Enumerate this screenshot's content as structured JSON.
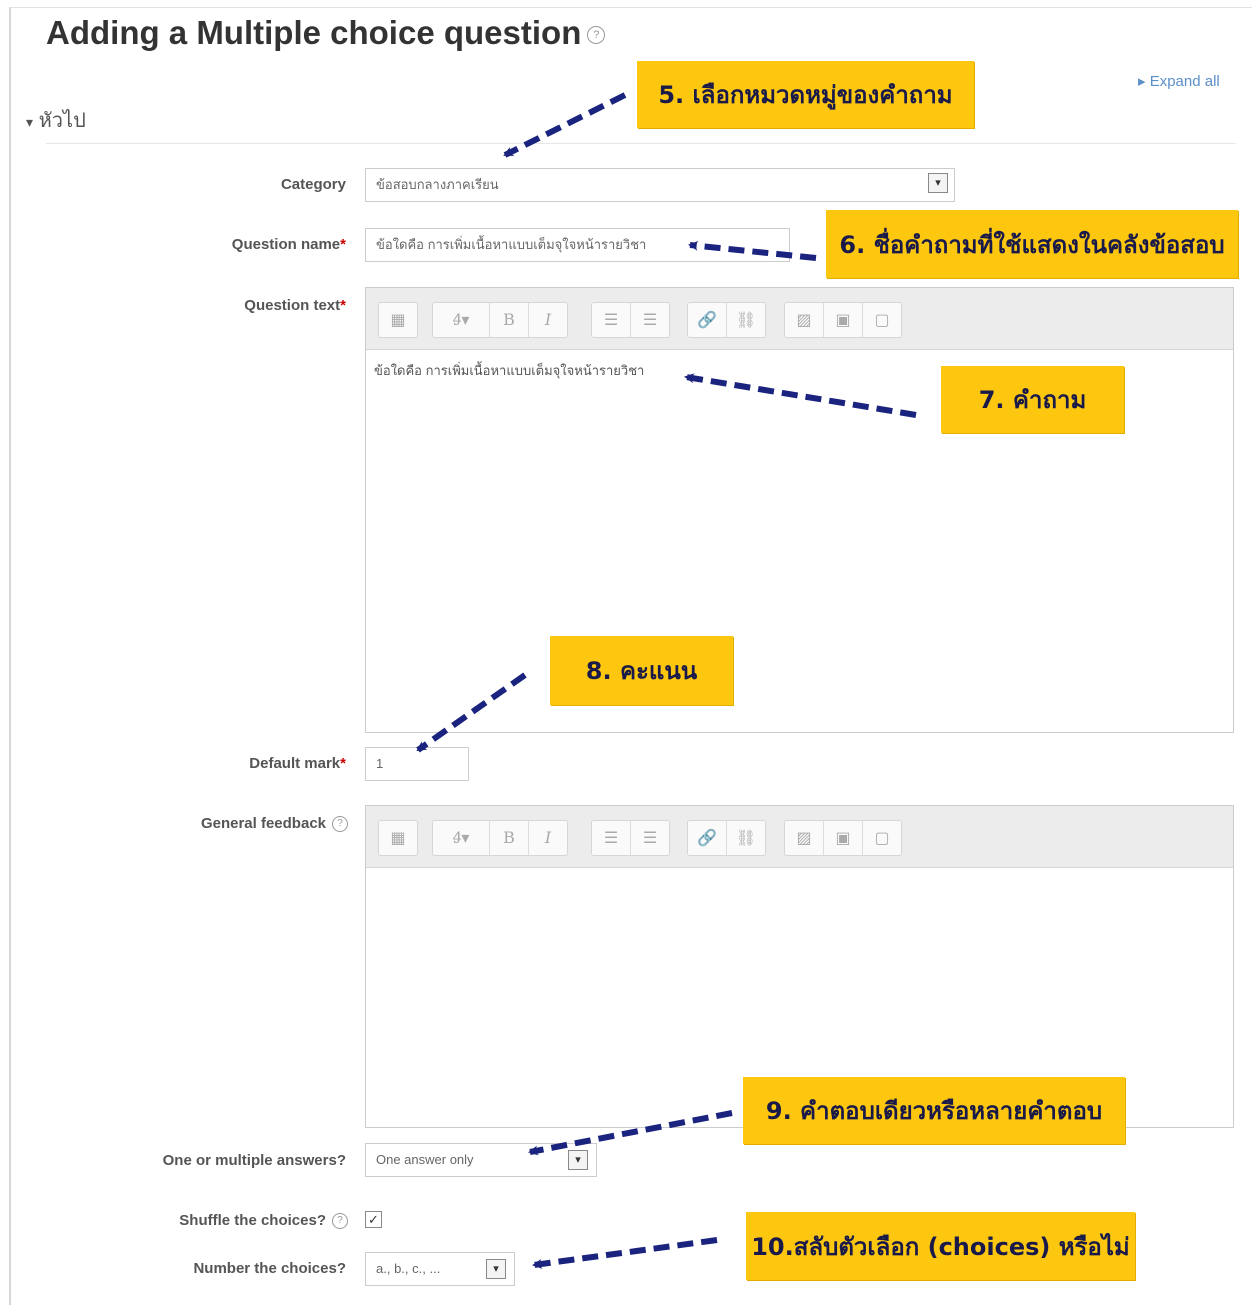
{
  "page": {
    "title": "Adding a Multiple choice question",
    "expand_all": "Expand all",
    "section": "หัวไป"
  },
  "form": {
    "category_label": "Category",
    "category_value": "ข้อสอบกลางภาคเรียน",
    "question_name_label": "Question name",
    "question_name_value": "ข้อใดคือ การเพิ่มเนื้อหาแบบเต็มจุใจหน้ารายวิชา",
    "question_text_label": "Question text",
    "question_text_value": "ข้อใดคือ การเพิ่มเนื้อหาแบบเต็มจุใจหน้ารายวิชา",
    "default_mark_label": "Default mark",
    "default_mark_value": "1",
    "general_feedback_label": "General feedback",
    "general_feedback_value": "",
    "answers_label": "One or multiple answers?",
    "answers_value": "One answer only",
    "shuffle_label": "Shuffle the choices?",
    "shuffle_checked": true,
    "number_label": "Number the choices?",
    "number_value": "a., b., c., ...",
    "required_marker": "*"
  },
  "toolbar": {
    "buttons": [
      "more-icon",
      "font-style-icon",
      "bold-icon",
      "italic-icon",
      "bullet-list-icon",
      "numbered-list-icon",
      "link-icon",
      "unlink-icon",
      "image-icon",
      "media-icon",
      "manage-files-icon"
    ],
    "glyphs": {
      "more": "▦",
      "style": "Ꜭ▾",
      "bold": "B",
      "italic": "I",
      "ul": "☰",
      "ol": "☰",
      "link": "🔗",
      "unlink": "⛓",
      "image": "▨",
      "media": "▣",
      "files": "▢"
    }
  },
  "annotations": {
    "note5": "5. เลือกหมวดหมู่ของคำถาม",
    "note6": "6. ชื่อคำถามที่ใช้แสดงในคลังข้อสอบ",
    "note7": "7. คำถาม",
    "note8": "8. คะแนน",
    "note9": "9. คำตอบเดียวหรือหลายคำตอบ",
    "note10": "10.สลับตัวเลือก (choices) หรือไม่",
    "note_color": "#fdc70f",
    "arrow_color": "#1a237e"
  }
}
